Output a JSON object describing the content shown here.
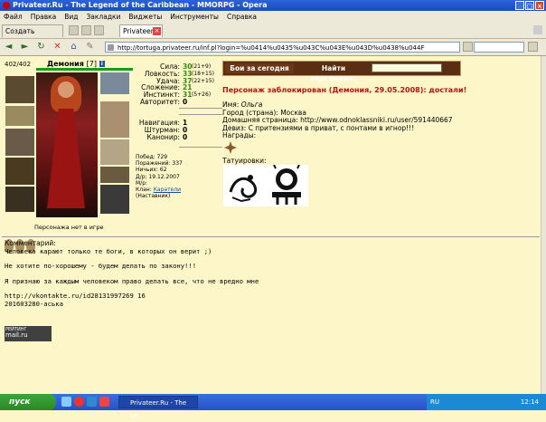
{
  "window": {
    "title": "Privateer.Ru - The Legend of the Caribbean - MMORPG - Opera"
  },
  "menu": [
    "Файл",
    "Правка",
    "Вид",
    "Закладки",
    "Виджеты",
    "Инструменты",
    "Справка"
  ],
  "tabs": {
    "new_tab_label": "Создать вкладку",
    "active_tab_label": "Privateer.Ru - The Lege..."
  },
  "address": {
    "url": "http://tortuga.privateer.ru/inf.pl?login=%u0414%u0435%u043C%u043E%u043D%u0438%u044F"
  },
  "character": {
    "hp": "402/402",
    "name": "Демония",
    "level": "[7]",
    "info_badge": "i",
    "not_in_game": "Персонажа нет в игре"
  },
  "stats": [
    {
      "label": "Сила:",
      "value": "30",
      "bonus": "(21+9)"
    },
    {
      "label": "Ловкость:",
      "value": "33",
      "bonus": "(18+15)"
    },
    {
      "label": "Удача:",
      "value": "37",
      "bonus": "(22+15)"
    },
    {
      "label": "Сложение:",
      "value": "21",
      "bonus": ""
    },
    {
      "label": "Инстинкт:",
      "value": "31",
      "bonus": "(5+26)"
    },
    {
      "label": "Авторитет:",
      "value": "0",
      "bonus": ""
    }
  ],
  "skills": [
    {
      "label": "Навигация:",
      "value": "1"
    },
    {
      "label": "Штурман:",
      "value": "0"
    },
    {
      "label": "Канонир:",
      "value": "0"
    }
  ],
  "record": {
    "wins": "Побед: 729",
    "losses": "Поражений: 337",
    "draws": "Ничьих: 62",
    "birthday": "Д/р: 19.12.2007",
    "mr": "М/р:",
    "clan_label": "Клан:",
    "clan_name": "Каратели",
    "clan_role": "(Наставник)"
  },
  "buttons": {
    "battles_today": "Бои за сегодня",
    "find_character": "Найти персонажа:"
  },
  "blocked_notice": "Персонаж заблокирован (Демония, 29.05.2008): достали!",
  "profile": {
    "name_label": "Имя:",
    "name_value": "Ольга",
    "city_label": "Город (страна):",
    "city_value": "Москва",
    "homepage_label": "Домашняя страница:",
    "homepage_value": "http://www.odnoklassniki.ru/user/591440667",
    "motto_label": "Девиз:",
    "motto_value": "С притензиями в приват, с понтами в игнор!!!",
    "awards_label": "Награды:",
    "tattoos_label": "Татуировки:"
  },
  "comment": {
    "heading": "Комментарий:",
    "line1": "Человека карают только те боги, в которых он верит ;)",
    "line2": "Не хотите по-хорошему - будем делать по закону!!!",
    "line3": "Я признаю за каждым человеком право делать все, что не вредно мне",
    "line4": "http://vkontakte.ru/id28131997269 16",
    "line5": "201603280-аська"
  },
  "counter": {
    "top": "РЕЙТИНГ",
    "bottom": "mail.ru"
  },
  "taskbar": {
    "start_label": "пуск",
    "task_label": "Privateer.Ru - The Le...",
    "lang": "RU",
    "clock": "12:14"
  }
}
